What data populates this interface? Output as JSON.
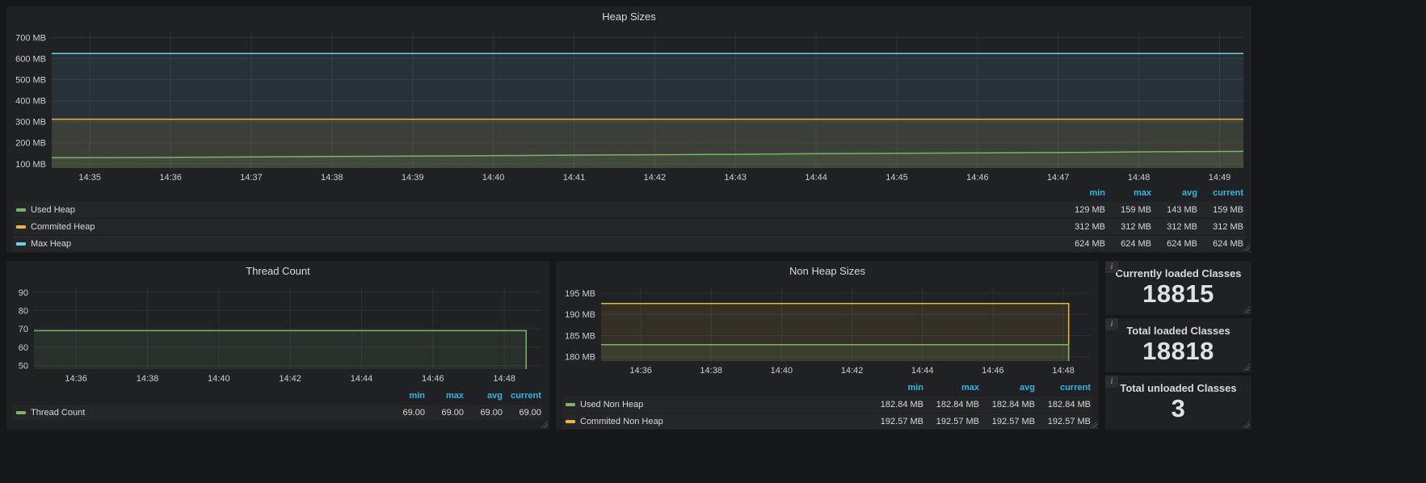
{
  "theme": {
    "page_bg": "#161719",
    "panel_bg": "#202124",
    "grid": "#2c3235",
    "text": "#d8d9da",
    "axis_text": "#c7d0d9",
    "header_blue": "#33b5e5",
    "series_green": "#7eb26d",
    "series_yellow": "#eab839",
    "series_blue": "#6ed0e0"
  },
  "panels": {
    "heap": {
      "title": "Heap Sizes",
      "legend_headers": [
        "min",
        "max",
        "avg",
        "current"
      ],
      "legend_rows": [
        {
          "label": "Used Heap",
          "color": "#7eb26d",
          "values": [
            "129 MB",
            "159 MB",
            "143 MB",
            "159 MB"
          ]
        },
        {
          "label": "Commited Heap",
          "color": "#eab839",
          "values": [
            "312 MB",
            "312 MB",
            "312 MB",
            "312 MB"
          ]
        },
        {
          "label": "Max Heap",
          "color": "#6ed0e0",
          "values": [
            "624 MB",
            "624 MB",
            "624 MB",
            "624 MB"
          ]
        }
      ]
    },
    "thread": {
      "title": "Thread Count",
      "legend_headers": [
        "min",
        "max",
        "avg",
        "current"
      ],
      "legend_rows": [
        {
          "label": "Thread Count",
          "color": "#7eb26d",
          "values": [
            "69.00",
            "69.00",
            "69.00",
            "69.00"
          ]
        }
      ]
    },
    "nonheap": {
      "title": "Non Heap Sizes",
      "legend_headers": [
        "min",
        "max",
        "avg",
        "current"
      ],
      "legend_rows": [
        {
          "label": "Used Non Heap",
          "color": "#7eb26d",
          "values": [
            "182.84 MB",
            "182.84 MB",
            "182.84 MB",
            "182.84 MB"
          ]
        },
        {
          "label": "Commited Non Heap",
          "color": "#eab839",
          "values": [
            "192.57 MB",
            "192.57 MB",
            "192.57 MB",
            "192.57 MB"
          ]
        }
      ]
    },
    "stats": [
      {
        "title": "Currently loaded Classes",
        "value": "18815"
      },
      {
        "title": "Total loaded Classes",
        "value": "18818"
      },
      {
        "title": "Total unloaded Classes",
        "value": "3"
      }
    ]
  },
  "chart_data": [
    {
      "id": "heap",
      "type": "line",
      "title": "Heap Sizes",
      "ylabel": "MB",
      "categories": [
        "14:35",
        "14:36",
        "14:37",
        "14:38",
        "14:39",
        "14:40",
        "14:41",
        "14:42",
        "14:43",
        "14:44",
        "14:45",
        "14:46",
        "14:47",
        "14:48",
        "14:49"
      ],
      "series": [
        {
          "name": "Used Heap",
          "color": "#7eb26d",
          "values": [
            129,
            130,
            132,
            134,
            136,
            138,
            141,
            143,
            145,
            148,
            150,
            152,
            154,
            157,
            159
          ]
        },
        {
          "name": "Commited Heap",
          "color": "#eab839",
          "values": [
            312,
            312,
            312,
            312,
            312,
            312,
            312,
            312,
            312,
            312,
            312,
            312,
            312,
            312,
            312
          ]
        },
        {
          "name": "Max Heap",
          "color": "#6ed0e0",
          "values": [
            624,
            624,
            624,
            624,
            624,
            624,
            624,
            624,
            624,
            624,
            624,
            624,
            624,
            624,
            624
          ]
        }
      ],
      "ylim": [
        80,
        725
      ],
      "y_ticks": [
        {
          "v": 100,
          "label": "100 MB"
        },
        {
          "v": 200,
          "label": "200 MB"
        },
        {
          "v": 300,
          "label": "300 MB"
        },
        {
          "v": 400,
          "label": "400 MB"
        },
        {
          "v": 500,
          "label": "500 MB"
        },
        {
          "v": 600,
          "label": "600 MB"
        },
        {
          "v": 700,
          "label": "700 MB"
        }
      ],
      "x_tick_start": 0.032,
      "x_tick_end": 0.98,
      "x_domain_frac": 1,
      "end_drop": false,
      "fill_opacity": 0.1,
      "grid": true,
      "legend_position": "bottom"
    },
    {
      "id": "thread",
      "type": "line",
      "title": "Thread Count",
      "categories": [
        "14:36",
        "14:38",
        "14:40",
        "14:42",
        "14:44",
        "14:46",
        "14:48"
      ],
      "series": [
        {
          "name": "Thread Count",
          "color": "#7eb26d",
          "values": [
            69,
            69,
            69,
            69,
            69,
            69,
            69
          ]
        }
      ],
      "ylim": [
        48,
        93
      ],
      "y_ticks": [
        {
          "v": 50,
          "label": "50"
        },
        {
          "v": 60,
          "label": "60"
        },
        {
          "v": 70,
          "label": "70"
        },
        {
          "v": 80,
          "label": "80"
        },
        {
          "v": 90,
          "label": "90"
        }
      ],
      "x_tick_start": 0.083,
      "x_tick_end": 0.927,
      "x_domain_frac": 0.97,
      "end_drop": true,
      "fill_opacity": 0.1,
      "grid": true,
      "legend_position": "bottom"
    },
    {
      "id": "nonheap",
      "type": "line",
      "title": "Non Heap Sizes",
      "ylabel": "MB",
      "categories": [
        "14:36",
        "14:38",
        "14:40",
        "14:42",
        "14:44",
        "14:46",
        "14:48"
      ],
      "series": [
        {
          "name": "Used Non Heap",
          "color": "#7eb26d",
          "values": [
            182.84,
            182.84,
            182.84,
            182.84,
            182.84,
            182.84,
            182.84
          ]
        },
        {
          "name": "Commited Non Heap",
          "color": "#eab839",
          "values": [
            192.57,
            192.57,
            192.57,
            192.57,
            192.57,
            192.57,
            192.57
          ]
        }
      ],
      "ylim": [
        179,
        196.5
      ],
      "y_ticks": [
        {
          "v": 180,
          "label": "180 MB"
        },
        {
          "v": 185,
          "label": "185 MB"
        },
        {
          "v": 190,
          "label": "190 MB"
        },
        {
          "v": 195,
          "label": "195 MB"
        }
      ],
      "x_tick_start": 0.081,
      "x_tick_end": 0.944,
      "x_domain_frac": 0.955,
      "end_drop": true,
      "fill_opacity": 0.1,
      "grid": true,
      "legend_position": "bottom"
    },
    {
      "id": "stat-currently-loaded-classes",
      "type": "stat",
      "title": "Currently loaded Classes",
      "value": 18815
    },
    {
      "id": "stat-total-loaded-classes",
      "type": "stat",
      "title": "Total loaded Classes",
      "value": 18818
    },
    {
      "id": "stat-total-unloaded-classes",
      "type": "stat",
      "title": "Total unloaded Classes",
      "value": 3
    }
  ]
}
